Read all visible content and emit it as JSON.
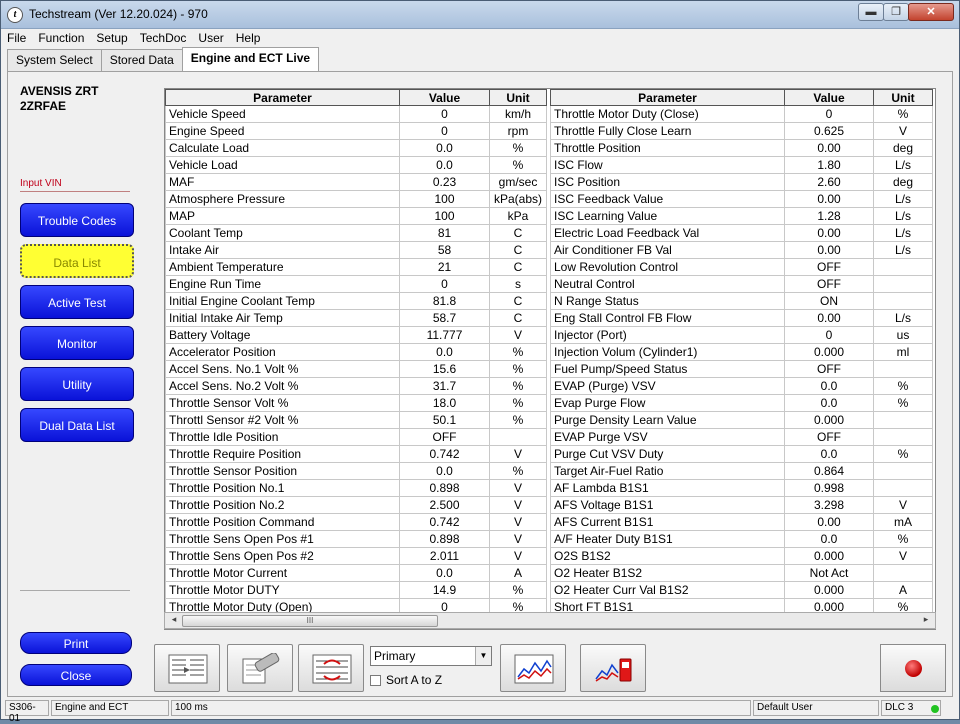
{
  "window": {
    "title": "Techstream (Ver 12.20.024) - 970",
    "minimize": "▬",
    "maximize": "❐",
    "close": "✕"
  },
  "menu": [
    "File",
    "Function",
    "Setup",
    "TechDoc",
    "User",
    "Help"
  ],
  "tabs": [
    "System Select",
    "Stored Data",
    "Engine and ECT Live"
  ],
  "vehicle": {
    "model": "AVENSIS ZRT",
    "engine": "2ZRFAE",
    "vin_label": "Input VIN"
  },
  "sidebar_buttons": [
    "Trouble Codes",
    "Data List",
    "Active Test",
    "Monitor",
    "Utility",
    "Dual Data List"
  ],
  "footer_buttons": {
    "print": "Print",
    "close": "Close"
  },
  "table": {
    "headers": [
      "Parameter",
      "Value",
      "Unit"
    ],
    "left": [
      [
        "Vehicle Speed",
        "0",
        "km/h"
      ],
      [
        "Engine Speed",
        "0",
        "rpm"
      ],
      [
        "Calculate Load",
        "0.0",
        "%"
      ],
      [
        "Vehicle Load",
        "0.0",
        "%"
      ],
      [
        "MAF",
        "0.23",
        "gm/sec"
      ],
      [
        "Atmosphere Pressure",
        "100",
        "kPa(abs)"
      ],
      [
        "MAP",
        "100",
        "kPa"
      ],
      [
        "Coolant Temp",
        "81",
        "C"
      ],
      [
        "Intake Air",
        "58",
        "C"
      ],
      [
        "Ambient Temperature",
        "21",
        "C"
      ],
      [
        "Engine Run Time",
        "0",
        "s"
      ],
      [
        "Initial Engine Coolant Temp",
        "81.8",
        "C"
      ],
      [
        "Initial Intake Air Temp",
        "58.7",
        "C"
      ],
      [
        "Battery Voltage",
        "11.777",
        "V"
      ],
      [
        "Accelerator Position",
        "0.0",
        "%"
      ],
      [
        "Accel Sens. No.1 Volt %",
        "15.6",
        "%"
      ],
      [
        "Accel Sens. No.2 Volt %",
        "31.7",
        "%"
      ],
      [
        "Throttle Sensor Volt %",
        "18.0",
        "%"
      ],
      [
        "Throttl Sensor #2 Volt %",
        "50.1",
        "%"
      ],
      [
        "Throttle Idle Position",
        "OFF",
        ""
      ],
      [
        "Throttle Require Position",
        "0.742",
        "V"
      ],
      [
        "Throttle Sensor Position",
        "0.0",
        "%"
      ],
      [
        "Throttle Position No.1",
        "0.898",
        "V"
      ],
      [
        "Throttle Position No.2",
        "2.500",
        "V"
      ],
      [
        "Throttle Position Command",
        "0.742",
        "V"
      ],
      [
        "Throttle Sens Open Pos #1",
        "0.898",
        "V"
      ],
      [
        "Throttle Sens Open Pos #2",
        "2.011",
        "V"
      ],
      [
        "Throttle Motor Current",
        "0.0",
        "A"
      ],
      [
        "Throttle Motor DUTY",
        "14.9",
        "%"
      ],
      [
        "Throttle Motor Duty (Open)",
        "0",
        "%"
      ]
    ],
    "right": [
      [
        "Throttle Motor Duty (Close)",
        "0",
        "%"
      ],
      [
        "Throttle Fully Close Learn",
        "0.625",
        "V"
      ],
      [
        "Throttle Position",
        "0.00",
        "deg"
      ],
      [
        "ISC Flow",
        "1.80",
        "L/s"
      ],
      [
        "ISC Position",
        "2.60",
        "deg"
      ],
      [
        "ISC Feedback Value",
        "0.00",
        "L/s"
      ],
      [
        "ISC Learning Value",
        "1.28",
        "L/s"
      ],
      [
        "Electric Load Feedback Val",
        "0.00",
        "L/s"
      ],
      [
        "Air Conditioner FB Val",
        "0.00",
        "L/s"
      ],
      [
        "Low Revolution Control",
        "OFF",
        ""
      ],
      [
        "Neutral Control",
        "OFF",
        ""
      ],
      [
        "N Range Status",
        "ON",
        ""
      ],
      [
        "Eng Stall Control FB Flow",
        "0.00",
        "L/s"
      ],
      [
        "Injector (Port)",
        "0",
        "us"
      ],
      [
        "Injection Volum (Cylinder1)",
        "0.000",
        "ml"
      ],
      [
        "Fuel Pump/Speed Status",
        "OFF",
        ""
      ],
      [
        "EVAP (Purge) VSV",
        "0.0",
        "%"
      ],
      [
        "Evap Purge Flow",
        "0.0",
        "%"
      ],
      [
        "Purge Density Learn Value",
        "0.000",
        ""
      ],
      [
        "EVAP Purge VSV",
        "OFF",
        ""
      ],
      [
        "Purge Cut VSV Duty",
        "0.0",
        "%"
      ],
      [
        "Target Air-Fuel Ratio",
        "0.864",
        ""
      ],
      [
        "AF Lambda B1S1",
        "0.998",
        ""
      ],
      [
        "AFS Voltage B1S1",
        "3.298",
        "V"
      ],
      [
        "AFS Current B1S1",
        "0.00",
        "mA"
      ],
      [
        "A/F Heater Duty B1S1",
        "0.0",
        "%"
      ],
      [
        "O2S B1S2",
        "0.000",
        "V"
      ],
      [
        "O2 Heater B1S2",
        "Not Act",
        ""
      ],
      [
        "O2 Heater Curr Val B1S2",
        "0.000",
        "A"
      ],
      [
        "Short FT B1S1",
        "0.000",
        "%"
      ]
    ]
  },
  "scroll": {
    "left": "◂",
    "right": "▸",
    "grip": "III"
  },
  "toolbar": {
    "select_value": "Primary",
    "select_arrow": "▼",
    "sort_label": "Sort A to Z"
  },
  "status": {
    "code": "S306-01",
    "system": "Engine and ECT",
    "interval": "100 ms",
    "user": "Default User",
    "dlc": "DLC 3"
  }
}
